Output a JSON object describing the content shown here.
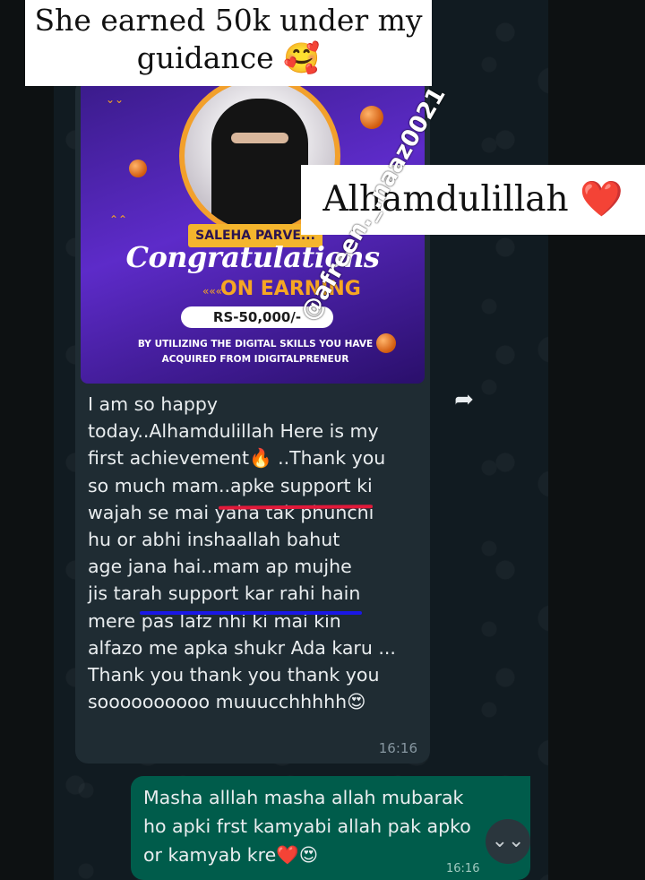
{
  "overlay": {
    "caption_top": "She earned 50k under my guidance 🥰",
    "caption_side": "Alhamdulillah",
    "caption_side_emoji": "❤️",
    "watermark": "@afreen._.naaz0021"
  },
  "poster": {
    "name": "SALEHA PARVE...",
    "congrats": "Congratulations",
    "earning": "ON EARNING",
    "amount": "RS-50,000/-",
    "note": "BY UTILIZING THE DIGITAL SKILLS YOU HAVE ACQUIRED FROM IDIGITALPRENEUR"
  },
  "incoming": {
    "text": "I am so happy\ntoday..Alhamdulillah Here is my\nfirst achievement🔥 ..Thank you\nso much mam..apke support ki\nwajah se mai yaha tak phunchi\nhu or abhi inshaallah bahut\nage jana hai..mam ap mujhe\njis tarah support kar rahi hain\nmere pas lafz nhi ki mai kin\nalfazo me apka shukr Ada karu ...\nThank you thank you thank you\nsoooooooooo muuucchhhhh😍",
    "time": "16:16"
  },
  "outgoing": {
    "text": "Masha alllah masha allah mubarak\nho apki frst kamyabi allah pak apko\nor kamyab kre❤️😍",
    "time": "16:16"
  },
  "icons": {
    "forward": "forward-icon",
    "scroll_down": "chevron-down-icon"
  },
  "colors": {
    "incoming_bubble": "#1f2c33",
    "outgoing_bubble": "#005c4b",
    "underline_red": "#e2193a",
    "underline_blue": "#1a17e6"
  }
}
